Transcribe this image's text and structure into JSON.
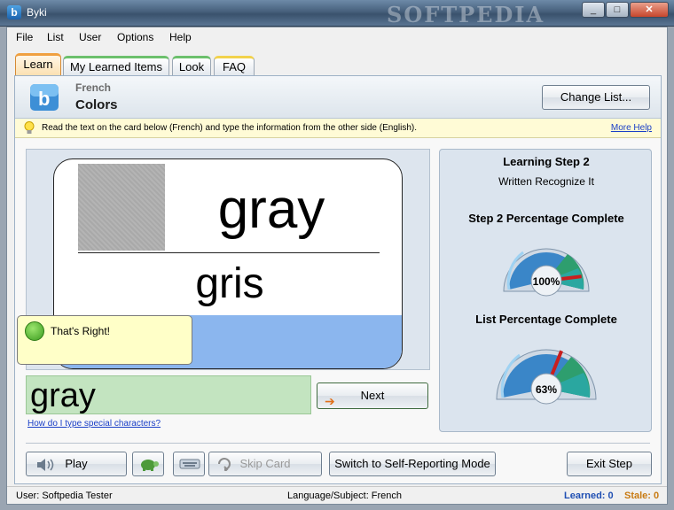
{
  "window": {
    "title": "Byki",
    "watermark": "SOFTPEDIA",
    "minimize": "_",
    "maximize": "□",
    "close": "✕"
  },
  "menu": [
    "File",
    "List",
    "User",
    "Options",
    "Help"
  ],
  "tabs": [
    "Learn",
    "My Learned Items",
    "Look",
    "FAQ"
  ],
  "header": {
    "language": "French",
    "list_name": "Colors",
    "change_list_label": "Change List..."
  },
  "hint": {
    "text": "Read the text on the card below (French) and type the information from the other side (English).",
    "more_help": "More Help"
  },
  "card": {
    "front": "gray",
    "back": "gris",
    "feedback": "That's Right!"
  },
  "answer": {
    "value": "gray",
    "next_label": "Next",
    "special_chars_link": "How do I type special characters?"
  },
  "stats": {
    "step_title": "Learning Step 2",
    "step_subtitle": "Written Recognize It",
    "step_pct_label": "Step 2 Percentage Complete",
    "step_pct_value": "100%",
    "step_pct": 1.0,
    "list_pct_label": "List Percentage Complete",
    "list_pct_value": "63%",
    "list_pct": 0.63
  },
  "buttons": {
    "play": "Play",
    "skip_card": "Skip Card",
    "self_reporting": "Switch to Self-Reporting Mode",
    "exit_step": "Exit Step"
  },
  "status": {
    "user": "User: Softpedia Tester",
    "language_subject": "Language/Subject: French",
    "learned": "Learned: 0",
    "stale": "Stale: 0"
  },
  "colors": {
    "accent_blue": "#1c63ad",
    "learned": "#1f4fb3",
    "stale": "#c87a12",
    "answer_bg": "#c3e4c0",
    "hint_bg": "#fffbd6"
  }
}
